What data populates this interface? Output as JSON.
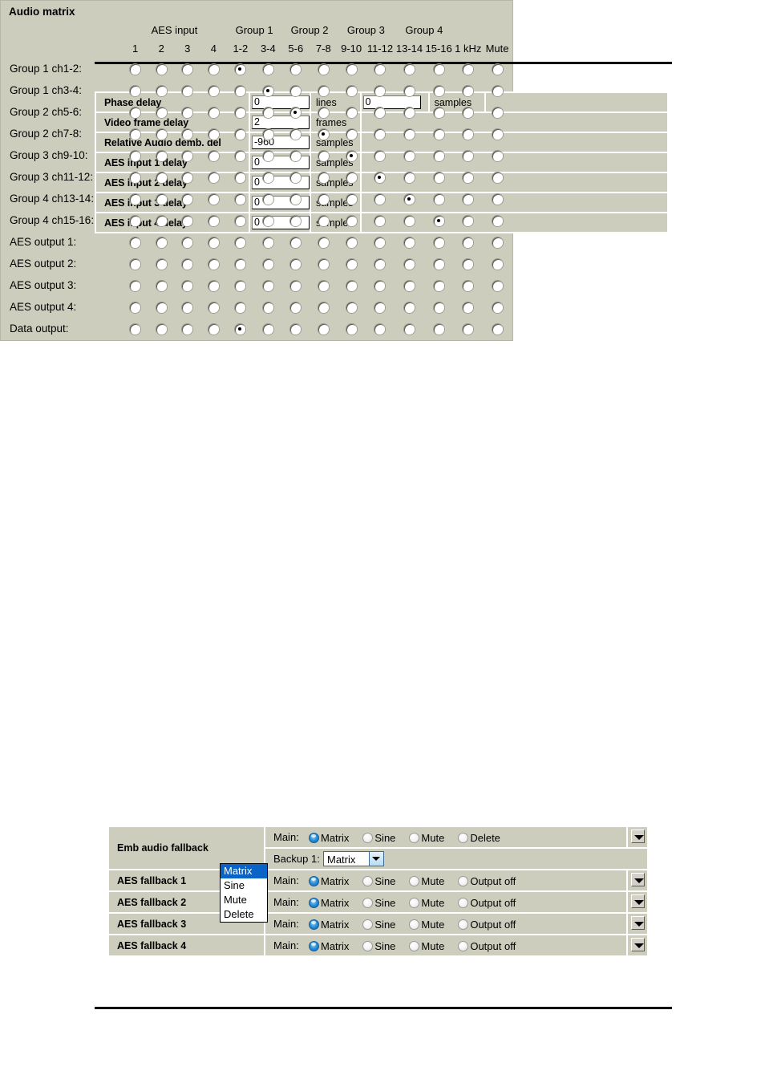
{
  "delay_table": {
    "rows": [
      {
        "label": "Phase delay",
        "value1": "0",
        "unit1": "lines",
        "value2": "0",
        "unit2": "samples"
      },
      {
        "label": "Video frame delay",
        "value1": "2",
        "unit1": "frames",
        "value2": null,
        "unit2": null
      },
      {
        "label": "Relative Audio demb. del",
        "value1": "-960",
        "unit1": "samples",
        "value2": null,
        "unit2": null
      },
      {
        "label": "AES input 1 delay",
        "value1": "0",
        "unit1": "samples",
        "value2": null,
        "unit2": null
      },
      {
        "label": "AES input 2 delay",
        "value1": "0",
        "unit1": "samples",
        "value2": null,
        "unit2": null
      },
      {
        "label": "AES input 3 delay",
        "value1": "0",
        "unit1": "samples",
        "value2": null,
        "unit2": null
      },
      {
        "label": "AES input 4 delay",
        "value1": "0",
        "unit1": "samples",
        "value2": null,
        "unit2": null
      }
    ]
  },
  "matrix": {
    "title": "Audio matrix",
    "group_headers": [
      {
        "label": "",
        "span": 1
      },
      {
        "label": "AES input",
        "span": 4
      },
      {
        "label": "Group 1",
        "span": 2
      },
      {
        "label": "Group 2",
        "span": 2
      },
      {
        "label": "Group 3",
        "span": 2
      },
      {
        "label": "Group 4",
        "span": 2
      },
      {
        "label": "",
        "span": 2
      }
    ],
    "columns": [
      "1",
      "2",
      "3",
      "4",
      "1-2",
      "3-4",
      "5-6",
      "7-8",
      "9-10",
      "11-12",
      "13-14",
      "15-16",
      "1 kHz",
      "Mute"
    ],
    "rows": [
      {
        "label": "Group 1 ch1-2:",
        "selected": 4
      },
      {
        "label": "Group 1 ch3-4:",
        "selected": 5
      },
      {
        "label": "Group 2 ch5-6:",
        "selected": 6
      },
      {
        "label": "Group 2 ch7-8:",
        "selected": 7
      },
      {
        "label": "Group 3 ch9-10:",
        "selected": 8
      },
      {
        "label": "Group 3 ch11-12:",
        "selected": 9
      },
      {
        "label": "Group 4 ch13-14:",
        "selected": 10
      },
      {
        "label": "Group 4 ch15-16:",
        "selected": 11
      },
      {
        "label": "AES output 1:",
        "selected": -1
      },
      {
        "label": "AES output 2:",
        "selected": -1
      },
      {
        "label": "AES output 3:",
        "selected": -1
      },
      {
        "label": "AES output 4:",
        "selected": -1
      },
      {
        "label": "Data output:",
        "selected": 4
      }
    ]
  },
  "fallback": {
    "rows": [
      {
        "label": "Emb audio fallback",
        "prefix": "Main:",
        "options": [
          "Matrix",
          "Sine",
          "Mute",
          "Delete"
        ],
        "selected": 0,
        "has_arrow": true
      },
      {
        "label": "",
        "prefix": "Backup 1:",
        "select_value": "Matrix",
        "is_select": true,
        "has_arrow": false
      },
      {
        "label": "AES fallback 1",
        "prefix": "Main:",
        "options": [
          "Matrix",
          "Sine",
          "Mute",
          "Output off"
        ],
        "selected": 0,
        "has_arrow": true
      },
      {
        "label": "AES fallback 2",
        "prefix": "Main:",
        "options": [
          "Matrix",
          "Sine",
          "Mute",
          "Output off"
        ],
        "selected": 0,
        "has_arrow": true
      },
      {
        "label": "AES fallback 3",
        "prefix": "Main:",
        "options": [
          "Matrix",
          "Sine",
          "Mute",
          "Output off"
        ],
        "selected": 0,
        "has_arrow": true
      },
      {
        "label": "AES fallback 4",
        "prefix": "Main:",
        "options": [
          "Matrix",
          "Sine",
          "Mute",
          "Output off"
        ],
        "selected": 0,
        "has_arrow": true
      }
    ],
    "dropdown_open": {
      "items": [
        "Matrix",
        "Sine",
        "Mute",
        "Delete"
      ],
      "highlighted": 0
    }
  },
  "colors": {
    "panel_bg": "#cdcdbe",
    "page_bg": "#ffffff",
    "highlight": "#0a64c8",
    "rule": "#000000"
  }
}
